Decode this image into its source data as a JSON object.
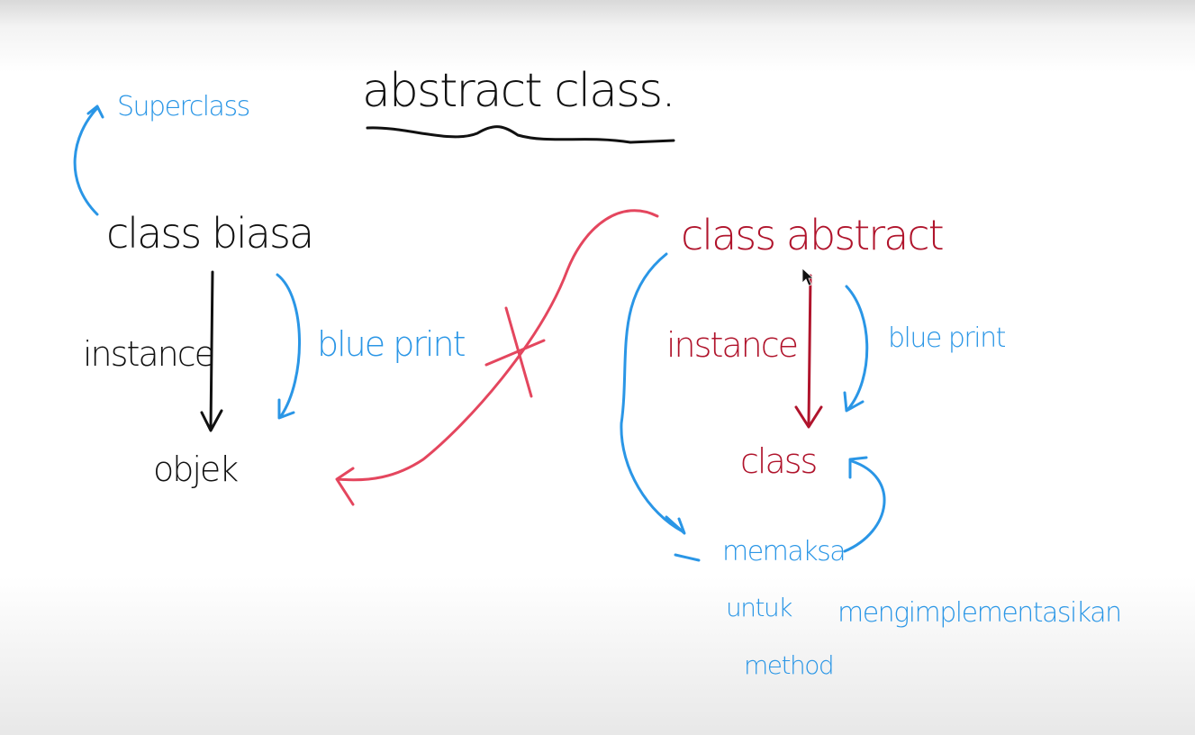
{
  "colors": {
    "ink": "#111111",
    "blue": "#2a96e6",
    "red": "#b0142c",
    "pink": "#e4465e"
  },
  "board": {
    "title": "abstract class.",
    "left": {
      "superclass": "Superclass",
      "class_basic": "class biasa",
      "instance": "instance",
      "blueprint": "blue print",
      "object": "objek"
    },
    "right": {
      "class_abstract": "class abstract",
      "instance": "instance",
      "blueprint": "blue print",
      "class": "class",
      "note_line1": "memaksa",
      "note_line2": "untuk",
      "note_line3": "method",
      "note_word": "mengimplementasikan"
    }
  }
}
